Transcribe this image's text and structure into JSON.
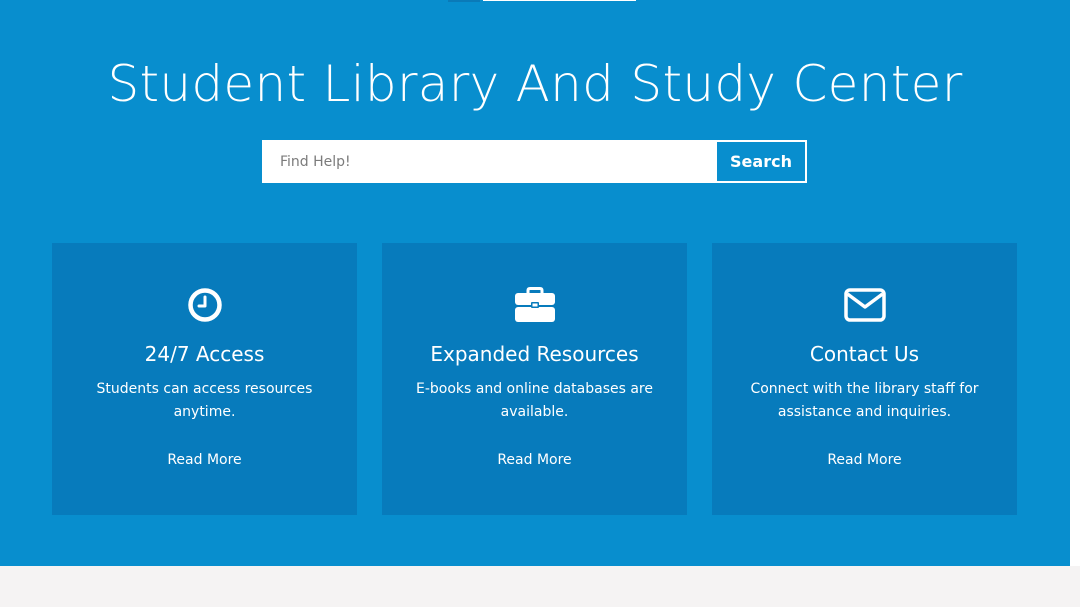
{
  "hero": {
    "title": "Student Library And Study Center"
  },
  "search": {
    "placeholder": "Find Help!",
    "value": "",
    "button_label": "Search"
  },
  "cards": [
    {
      "icon": "clock-icon",
      "title": "24/7 Access",
      "text": "Students can access resources anytime.",
      "link": "Read More"
    },
    {
      "icon": "briefcase-icon",
      "title": "Expanded Resources",
      "text": "E-books and online databases are available.",
      "link": "Read More"
    },
    {
      "icon": "envelope-icon",
      "title": "Contact Us",
      "text": "Connect with the library staff for assistance and inquiries.",
      "link": "Read More"
    }
  ],
  "colors": {
    "hero_background": "#088ece",
    "card_background": "#077bbc",
    "text": "#ffffff",
    "footer_background": "#f5f3f3"
  }
}
